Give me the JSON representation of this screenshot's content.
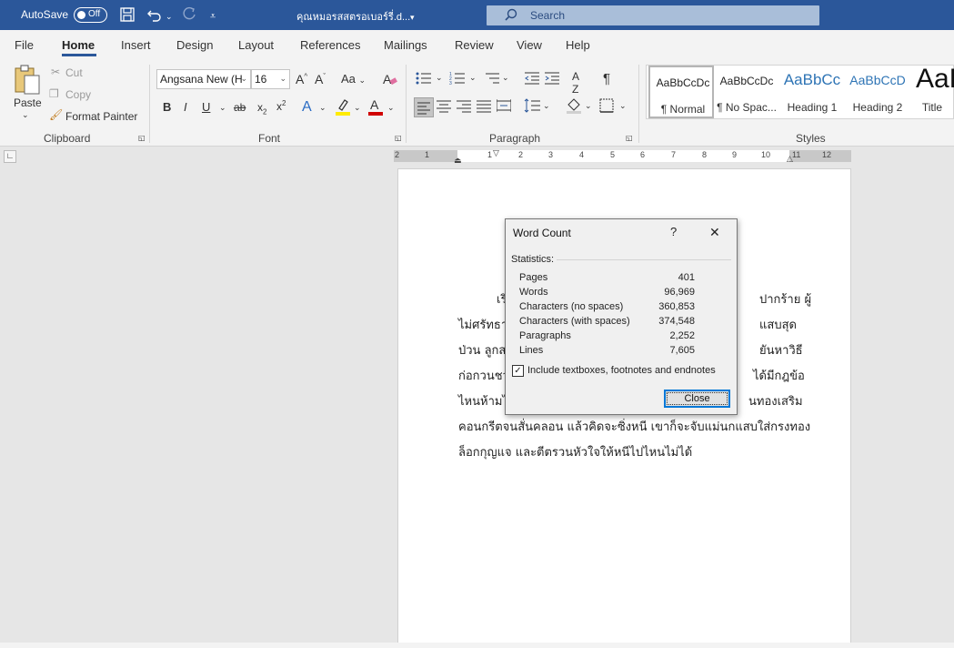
{
  "titlebar": {
    "autosave_label": "AutoSave",
    "autosave_state": "Off",
    "document_title": "คุณหมอรสสตรอเบอร์รี่.d...",
    "search_placeholder": "Search"
  },
  "menu": {
    "tabs": [
      {
        "label": "File"
      },
      {
        "label": "Home"
      },
      {
        "label": "Insert"
      },
      {
        "label": "Design"
      },
      {
        "label": "Layout"
      },
      {
        "label": "References"
      },
      {
        "label": "Mailings"
      },
      {
        "label": "Review"
      },
      {
        "label": "View"
      },
      {
        "label": "Help"
      }
    ],
    "active": "Home"
  },
  "ribbon": {
    "clipboard": {
      "paste": "Paste",
      "cut": "Cut",
      "copy": "Copy",
      "format_painter": "Format Painter",
      "group_label": "Clipboard"
    },
    "font": {
      "font_name": "Angsana New (H",
      "font_size": "16",
      "group_label": "Font",
      "change_case": "Aa"
    },
    "paragraph": {
      "group_label": "Paragraph"
    },
    "styles": {
      "group_label": "Styles",
      "items": [
        {
          "preview": "AaBbCcDc",
          "name": "¶ Normal"
        },
        {
          "preview": "AaBbCcDc",
          "name": "¶ No Spac..."
        },
        {
          "preview": "AaBbCc",
          "name": "Heading 1"
        },
        {
          "preview": "AaBbCcD",
          "name": "Heading 2"
        },
        {
          "preview": "AaB",
          "name": "Title"
        }
      ]
    }
  },
  "ruler": {
    "labels": [
      "2",
      "1",
      "1",
      "1",
      "2",
      "3",
      "4",
      "5",
      "6",
      "7",
      "8",
      "9",
      "10",
      "11",
      "12"
    ]
  },
  "document": {
    "lines": [
      "เริ่",
      "ไม่ศรัทธา",
      "ป่วน ลูกส",
      "ก่อกวนชว",
      "ไหนห้ามไ",
      "คอนกรีตจนสั่นคลอน แล้วคิดจะซิ่งหนี เขาก็จะจับแม่นกแสบใส่กรงทอง",
      "ล็อกกุญแจ และตีตรวนหัวใจให้หนีไปไหนไม่ได้"
    ],
    "right_fragments": [
      "ปากร้าย ผู้",
      "แสบสุด",
      "ยันหาวิธี",
      "ได้มีกฎข้อ",
      "นทองเสริม"
    ]
  },
  "word_count_dialog": {
    "title": "Word Count",
    "help": "?",
    "statistics_label": "Statistics:",
    "rows": [
      {
        "label": "Pages",
        "value": "401"
      },
      {
        "label": "Words",
        "value": "96,969"
      },
      {
        "label": "Characters (no spaces)",
        "value": "360,853"
      },
      {
        "label": "Characters (with spaces)",
        "value": "374,548"
      },
      {
        "label": "Paragraphs",
        "value": "2,252"
      },
      {
        "label": "Lines",
        "value": "7,605"
      }
    ],
    "include_checkbox": {
      "label": "Include textboxes, footnotes and endnotes",
      "checked": true
    },
    "close_label": "Close"
  },
  "colors": {
    "titlebar": "#2b579a",
    "accent": "#0078d7",
    "highlight_yellow": "#ffeb00",
    "font_red": "#d00000"
  }
}
